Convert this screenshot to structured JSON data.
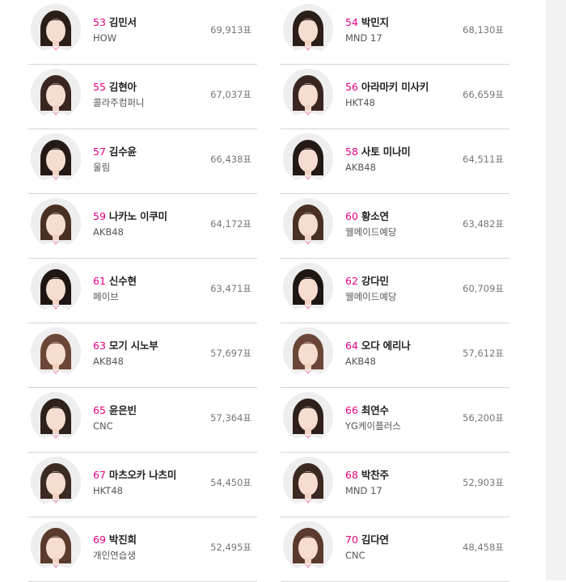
{
  "colors": {
    "rank": "#e4007f",
    "divider": "#d4d4d4"
  },
  "rows": [
    {
      "left": {
        "rank": "53",
        "name": "김민서",
        "agency": "HOW",
        "votes": "69,913표"
      },
      "right": {
        "rank": "54",
        "name": "박민지",
        "agency": "MND 17",
        "votes": "68,130표"
      }
    },
    {
      "left": {
        "rank": "55",
        "name": "김현아",
        "agency": "콜라주컴퍼니",
        "votes": "67,037표"
      },
      "right": {
        "rank": "56",
        "name": "아라마키 미사키",
        "agency": "HKT48",
        "votes": "66,659표"
      }
    },
    {
      "left": {
        "rank": "57",
        "name": "김수윤",
        "agency": "울림",
        "votes": "66,438표"
      },
      "right": {
        "rank": "58",
        "name": "사토 미나미",
        "agency": "AKB48",
        "votes": "64,511표"
      }
    },
    {
      "left": {
        "rank": "59",
        "name": "나카노 이쿠미",
        "agency": "AKB48",
        "votes": "64,172표"
      },
      "right": {
        "rank": "60",
        "name": "황소연",
        "agency": "웰메이드예당",
        "votes": "63,482표"
      }
    },
    {
      "left": {
        "rank": "61",
        "name": "신수현",
        "agency": "페이브",
        "votes": "63,471표"
      },
      "right": {
        "rank": "62",
        "name": "강다민",
        "agency": "웰메이드예당",
        "votes": "60,709표"
      }
    },
    {
      "left": {
        "rank": "63",
        "name": "모기 시노부",
        "agency": "AKB48",
        "votes": "57,697표"
      },
      "right": {
        "rank": "64",
        "name": "오다 에리나",
        "agency": "AKB48",
        "votes": "57,612표"
      }
    },
    {
      "left": {
        "rank": "65",
        "name": "윤은빈",
        "agency": "CNC",
        "votes": "57,364표"
      },
      "right": {
        "rank": "66",
        "name": "최연수",
        "agency": "YG케이플러스",
        "votes": "56,200표"
      }
    },
    {
      "left": {
        "rank": "67",
        "name": "마츠오카 나츠미",
        "agency": "HKT48",
        "votes": "54,450표"
      },
      "right": {
        "rank": "68",
        "name": "박찬주",
        "agency": "MND 17",
        "votes": "52,903표"
      }
    },
    {
      "left": {
        "rank": "69",
        "name": "박진희",
        "agency": "개인연습생",
        "votes": "52,495표"
      },
      "right": {
        "rank": "70",
        "name": "김다연",
        "agency": "CNC",
        "votes": "48,458표"
      }
    }
  ]
}
